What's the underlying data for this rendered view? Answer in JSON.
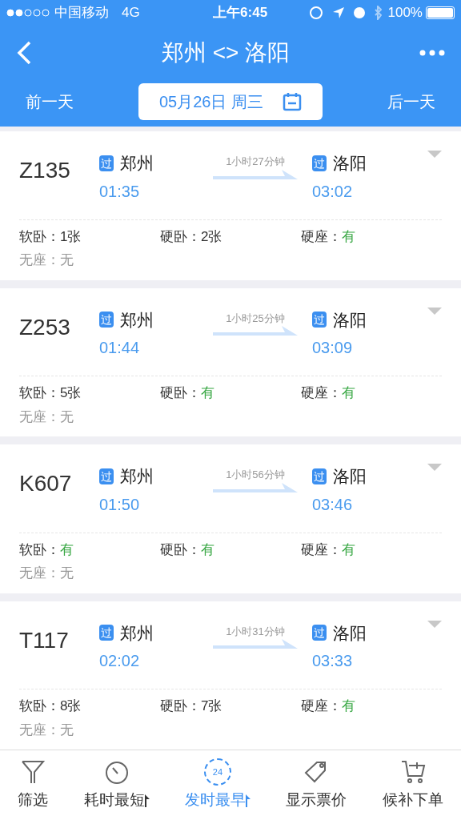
{
  "status_bar": {
    "carrier": "中国移动",
    "network": "4G",
    "time": "上午6:45",
    "battery": "100%"
  },
  "nav": {
    "title": "郑州 <> 洛阳"
  },
  "date_bar": {
    "prev": "前一天",
    "date": "05月26日 周三",
    "next": "后一天"
  },
  "trains": [
    {
      "number": "Z135",
      "from": "郑州",
      "from_badge": "过",
      "depart": "01:35",
      "duration": "1小时27分钟",
      "to": "洛阳",
      "to_badge": "过",
      "arrive": "03:02",
      "seats": [
        {
          "name": "软卧：",
          "value": "1张",
          "disabled": false,
          "color": "#333333"
        },
        {
          "name": "硬卧：",
          "value": "2张",
          "disabled": false,
          "color": "#333333"
        },
        {
          "name": "硬座：",
          "value": "有",
          "disabled": false,
          "color": "#3aa845"
        },
        {
          "name": "无座：",
          "value": "无",
          "disabled": true,
          "color": "#999999"
        }
      ]
    },
    {
      "number": "Z253",
      "from": "郑州",
      "from_badge": "过",
      "depart": "01:44",
      "duration": "1小时25分钟",
      "to": "洛阳",
      "to_badge": "过",
      "arrive": "03:09",
      "seats": [
        {
          "name": "软卧：",
          "value": "5张",
          "disabled": false,
          "color": "#333333"
        },
        {
          "name": "硬卧：",
          "value": "有",
          "disabled": false,
          "color": "#3aa845"
        },
        {
          "name": "硬座：",
          "value": "有",
          "disabled": false,
          "color": "#3aa845"
        },
        {
          "name": "无座：",
          "value": "无",
          "disabled": true,
          "color": "#999999"
        }
      ]
    },
    {
      "number": "K607",
      "from": "郑州",
      "from_badge": "过",
      "depart": "01:50",
      "duration": "1小时56分钟",
      "to": "洛阳",
      "to_badge": "过",
      "arrive": "03:46",
      "seats": [
        {
          "name": "软卧：",
          "value": "有",
          "disabled": false,
          "color": "#3aa845"
        },
        {
          "name": "硬卧：",
          "value": "有",
          "disabled": false,
          "color": "#3aa845"
        },
        {
          "name": "硬座：",
          "value": "有",
          "disabled": false,
          "color": "#3aa845"
        },
        {
          "name": "无座：",
          "value": "无",
          "disabled": true,
          "color": "#999999"
        }
      ]
    },
    {
      "number": "T117",
      "from": "郑州",
      "from_badge": "过",
      "depart": "02:02",
      "duration": "1小时31分钟",
      "to": "洛阳",
      "to_badge": "过",
      "arrive": "03:33",
      "seats": [
        {
          "name": "软卧：",
          "value": "8张",
          "disabled": false,
          "color": "#333333"
        },
        {
          "name": "硬卧：",
          "value": "7张",
          "disabled": false,
          "color": "#333333"
        },
        {
          "name": "硬座：",
          "value": "有",
          "disabled": false,
          "color": "#3aa845"
        },
        {
          "name": "无座：",
          "value": "无",
          "disabled": true,
          "color": "#999999"
        }
      ]
    }
  ],
  "tab_bar": [
    {
      "kind": "filter",
      "label": "筛选",
      "selected": false,
      "sortable": false
    },
    {
      "kind": "timer",
      "label": "耗时最短",
      "selected": false,
      "sortable": true
    },
    {
      "kind": "clock",
      "label": "发时最早",
      "selected": true,
      "sortable": true,
      "icon_text": "24"
    },
    {
      "kind": "tag",
      "label": "显示票价",
      "selected": false,
      "sortable": false
    },
    {
      "kind": "cart",
      "label": "候补下单",
      "selected": false,
      "sortable": false
    }
  ]
}
